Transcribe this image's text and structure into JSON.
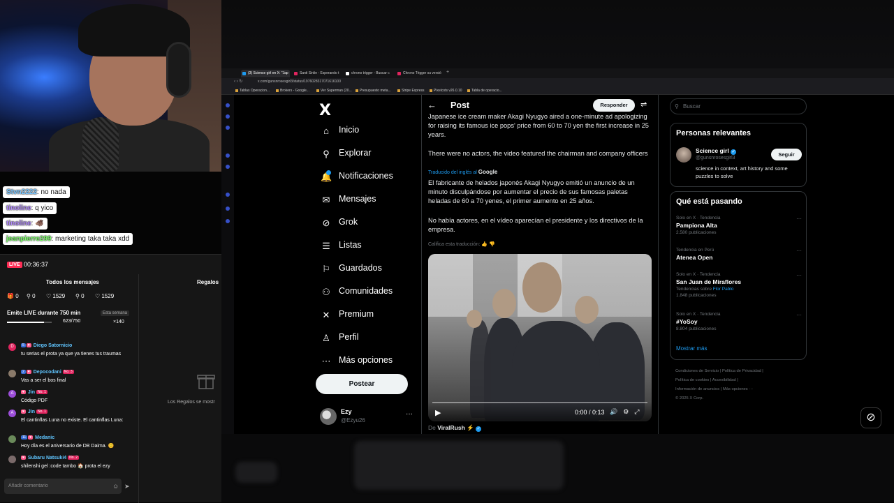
{
  "stream_overlay": {
    "messages": [
      {
        "user": "Stvn2222",
        "text": ": no nada",
        "color": "#7ec8ff"
      },
      {
        "user": "tinoline",
        "text": ": q yico",
        "color": "#b48cff"
      },
      {
        "user": "tinoline",
        "text": ": 🐗",
        "color": "#b48cff"
      },
      {
        "user": "jeanpierre299",
        "text": ": marketing taka taka xdd",
        "color": "#7dff6b"
      }
    ]
  },
  "live_panel": {
    "badge": "LIVE",
    "timer": "00:36:37",
    "tab_all": "Todos los mensajes",
    "tab_gifts": "Regalos",
    "stats": [
      "0",
      "0",
      "1529",
      "0",
      "1529"
    ],
    "goal_title": "Emite LIVE durante 750 min",
    "goal_week": "Esta semana",
    "goal_progress": "623/750",
    "goal_fraction": 0.83,
    "goal_multiplier": "×140",
    "messages": [
      {
        "initial": "D",
        "avatar_color": "#e0245e",
        "level": "5",
        "name": "Diego Satornicio",
        "rank": "",
        "text": "tu serias el prota ya que ya tienes tus traumas"
      },
      {
        "initial": "",
        "avatar_color": "#8a7a6a",
        "level": "2",
        "name": "Depocodani",
        "rank": "No. 3",
        "text": "Vas a ser el bos final"
      },
      {
        "initial": "A",
        "avatar_color": "#9b4dd8",
        "level": "",
        "name": "Jin",
        "rank": "No. 1",
        "text": "Código PDF"
      },
      {
        "initial": "A",
        "avatar_color": "#9b4dd8",
        "level": "",
        "name": "Jin",
        "rank": "No. 1",
        "text": "El cantinflas Luna no existe. El cantinflas Luna:"
      },
      {
        "initial": "",
        "avatar_color": "#6a8a5a",
        "level": "11",
        "name": "Medanic",
        "rank": "",
        "text": "Hoy día es el aniversario de DB Daima. 😊"
      },
      {
        "initial": "",
        "avatar_color": "#7a6a6a",
        "level": "",
        "name": "Subaru Natsuki4",
        "rank": "No. 2",
        "text": "shilenshi gel :code tambo 🏠 prota el ezy"
      }
    ],
    "gifts_empty": "Los Regalos se mostr",
    "comment_placeholder": "Añadir comentario"
  },
  "browser": {
    "tabs": [
      {
        "label": "(3) Science girl en X: \"Jap",
        "color": "#1d9bf0",
        "active": true
      },
      {
        "label": "Santi Sinlin - Esperando t",
        "color": "#e0245e",
        "active": false
      },
      {
        "label": "chrono trigger - Buscar c",
        "color": "#ffffff",
        "active": false
      },
      {
        "label": "Chrono Trigger su versió",
        "color": "#e0245e",
        "active": false
      }
    ],
    "url": "x.com/gunsnrosesgirl3/status/1976028317071616100",
    "bookmarks": [
      "Tablas Operacion...",
      "Brokers - Google...",
      "Ver Superman (20...",
      "Presupuesto meta...",
      "Stripe Express",
      "Pixelcots v26.0.10",
      "Tabla de operacio..."
    ]
  },
  "x": {
    "logo": "X",
    "nav": [
      {
        "icon": "home-icon",
        "glyph": "⌂",
        "label": "Inicio"
      },
      {
        "icon": "search-icon",
        "glyph": "⚲",
        "label": "Explorar"
      },
      {
        "icon": "bell-icon",
        "glyph": "🔔",
        "label": "Notificaciones"
      },
      {
        "icon": "mail-icon",
        "glyph": "✉",
        "label": "Mensajes"
      },
      {
        "icon": "grok-icon",
        "glyph": "⊘",
        "label": "Grok"
      },
      {
        "icon": "list-icon",
        "glyph": "☰",
        "label": "Listas"
      },
      {
        "icon": "bookmark-icon",
        "glyph": "⚐",
        "label": "Guardados"
      },
      {
        "icon": "communities-icon",
        "glyph": "⚇",
        "label": "Comunidades"
      },
      {
        "icon": "premium-icon",
        "glyph": "✕",
        "label": "Premium"
      },
      {
        "icon": "profile-icon",
        "glyph": "♙",
        "label": "Perfil"
      },
      {
        "icon": "more-icon",
        "glyph": "⋯",
        "label": "Más opciones"
      }
    ],
    "post_button": "Postear",
    "me": {
      "name": "Ezy",
      "handle": "@Ezyu26"
    },
    "header_title": "Post",
    "reply_button": "Responder",
    "post": {
      "original_1": "Japanese ice cream maker Akagi Nyugyo aired a one-minute ad apologizing for raising its famous ice pops' price from 60 to 70 yen the first increase in 25 years.",
      "original_2": "There were no actors,  the video featured the chairman and company officers",
      "translated_label": "Traducido del inglés al",
      "translated_brand": "Google",
      "translated_1": "El fabricante de helados japonés Akagi Nyugyo emitió un anuncio de un minuto disculpándose por aumentar el precio de sus famosas paletas heladas de 60 a 70 yenes, el primer aumento en 25 años.",
      "translated_2": "No había actores, en el vídeo aparecían el presidente y los directivos de la empresa.",
      "rate_translation": "Califica esta traducción:",
      "video_time": "0:00 / 0:13",
      "from_label": "De",
      "from_name": "ViralRush ⚡"
    },
    "search_placeholder": "Buscar",
    "relevant": {
      "title": "Personas relevantes",
      "name": "Science girl",
      "handle": "@gunsnrosesgirl3",
      "bio": "science in context, art history and some puzzles to solve",
      "follow": "Seguir"
    },
    "trends": {
      "title": "Qué está pasando",
      "items": [
        {
          "context": "Solo en X · Tendencia",
          "name": "Pampiona Alta",
          "count": "2.580 publicaciones",
          "link": ""
        },
        {
          "context": "Tendencia en Perú",
          "name": "Atenea Open",
          "count": "",
          "link": ""
        },
        {
          "context": "Solo en X · Tendencia",
          "name": "San Juan de Miraflores",
          "count": "Tendencias sobre",
          "link": "Flor Pablo",
          "extra": "1.848 publicaciones"
        },
        {
          "context": "Solo en X · Tendencia",
          "name": "#YoSoy",
          "count": "8.804 publicaciones",
          "link": ""
        }
      ],
      "show_more": "Mostrar más"
    },
    "footer": [
      "Condiciones de Servicio",
      "Política de Privacidad",
      "Política de cookies",
      "Accesibilidad",
      "Información de anuncios",
      "Más opciones ···",
      "© 2025 X Corp."
    ]
  }
}
